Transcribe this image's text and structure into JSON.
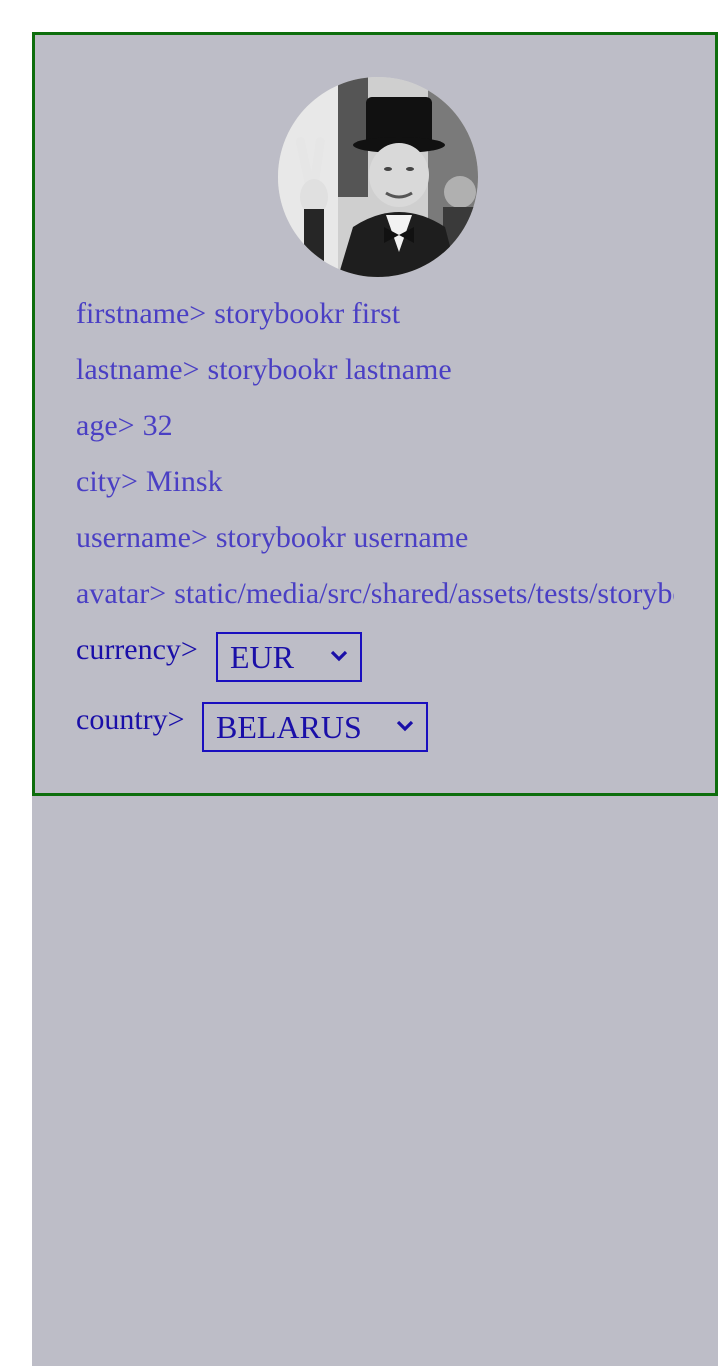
{
  "profile": {
    "fields": [
      {
        "label": "firstname>",
        "value": "storybookr first"
      },
      {
        "label": "lastname>",
        "value": "storybookr lastname"
      },
      {
        "label": "age>",
        "value": "32"
      },
      {
        "label": "city>",
        "value": "Minsk"
      },
      {
        "label": "username>",
        "value": "storybookr username"
      },
      {
        "label": "avatar>",
        "value": "static/media/src/shared/assets/tests/storybook.jpg"
      }
    ],
    "currency": {
      "label": "currency>",
      "selected": "EUR"
    },
    "country": {
      "label": "country>",
      "selected": "BELARUS"
    }
  },
  "colors": {
    "page_background": "#bdbdc7",
    "card_border": "#0d6e0d",
    "field_text": "#4a3fc4",
    "select_text": "#1a0fa8",
    "select_border": "#1a0fbf"
  },
  "icons": {
    "avatar_image": "portrait-photo",
    "select_chevron": "chevron-down-icon"
  }
}
